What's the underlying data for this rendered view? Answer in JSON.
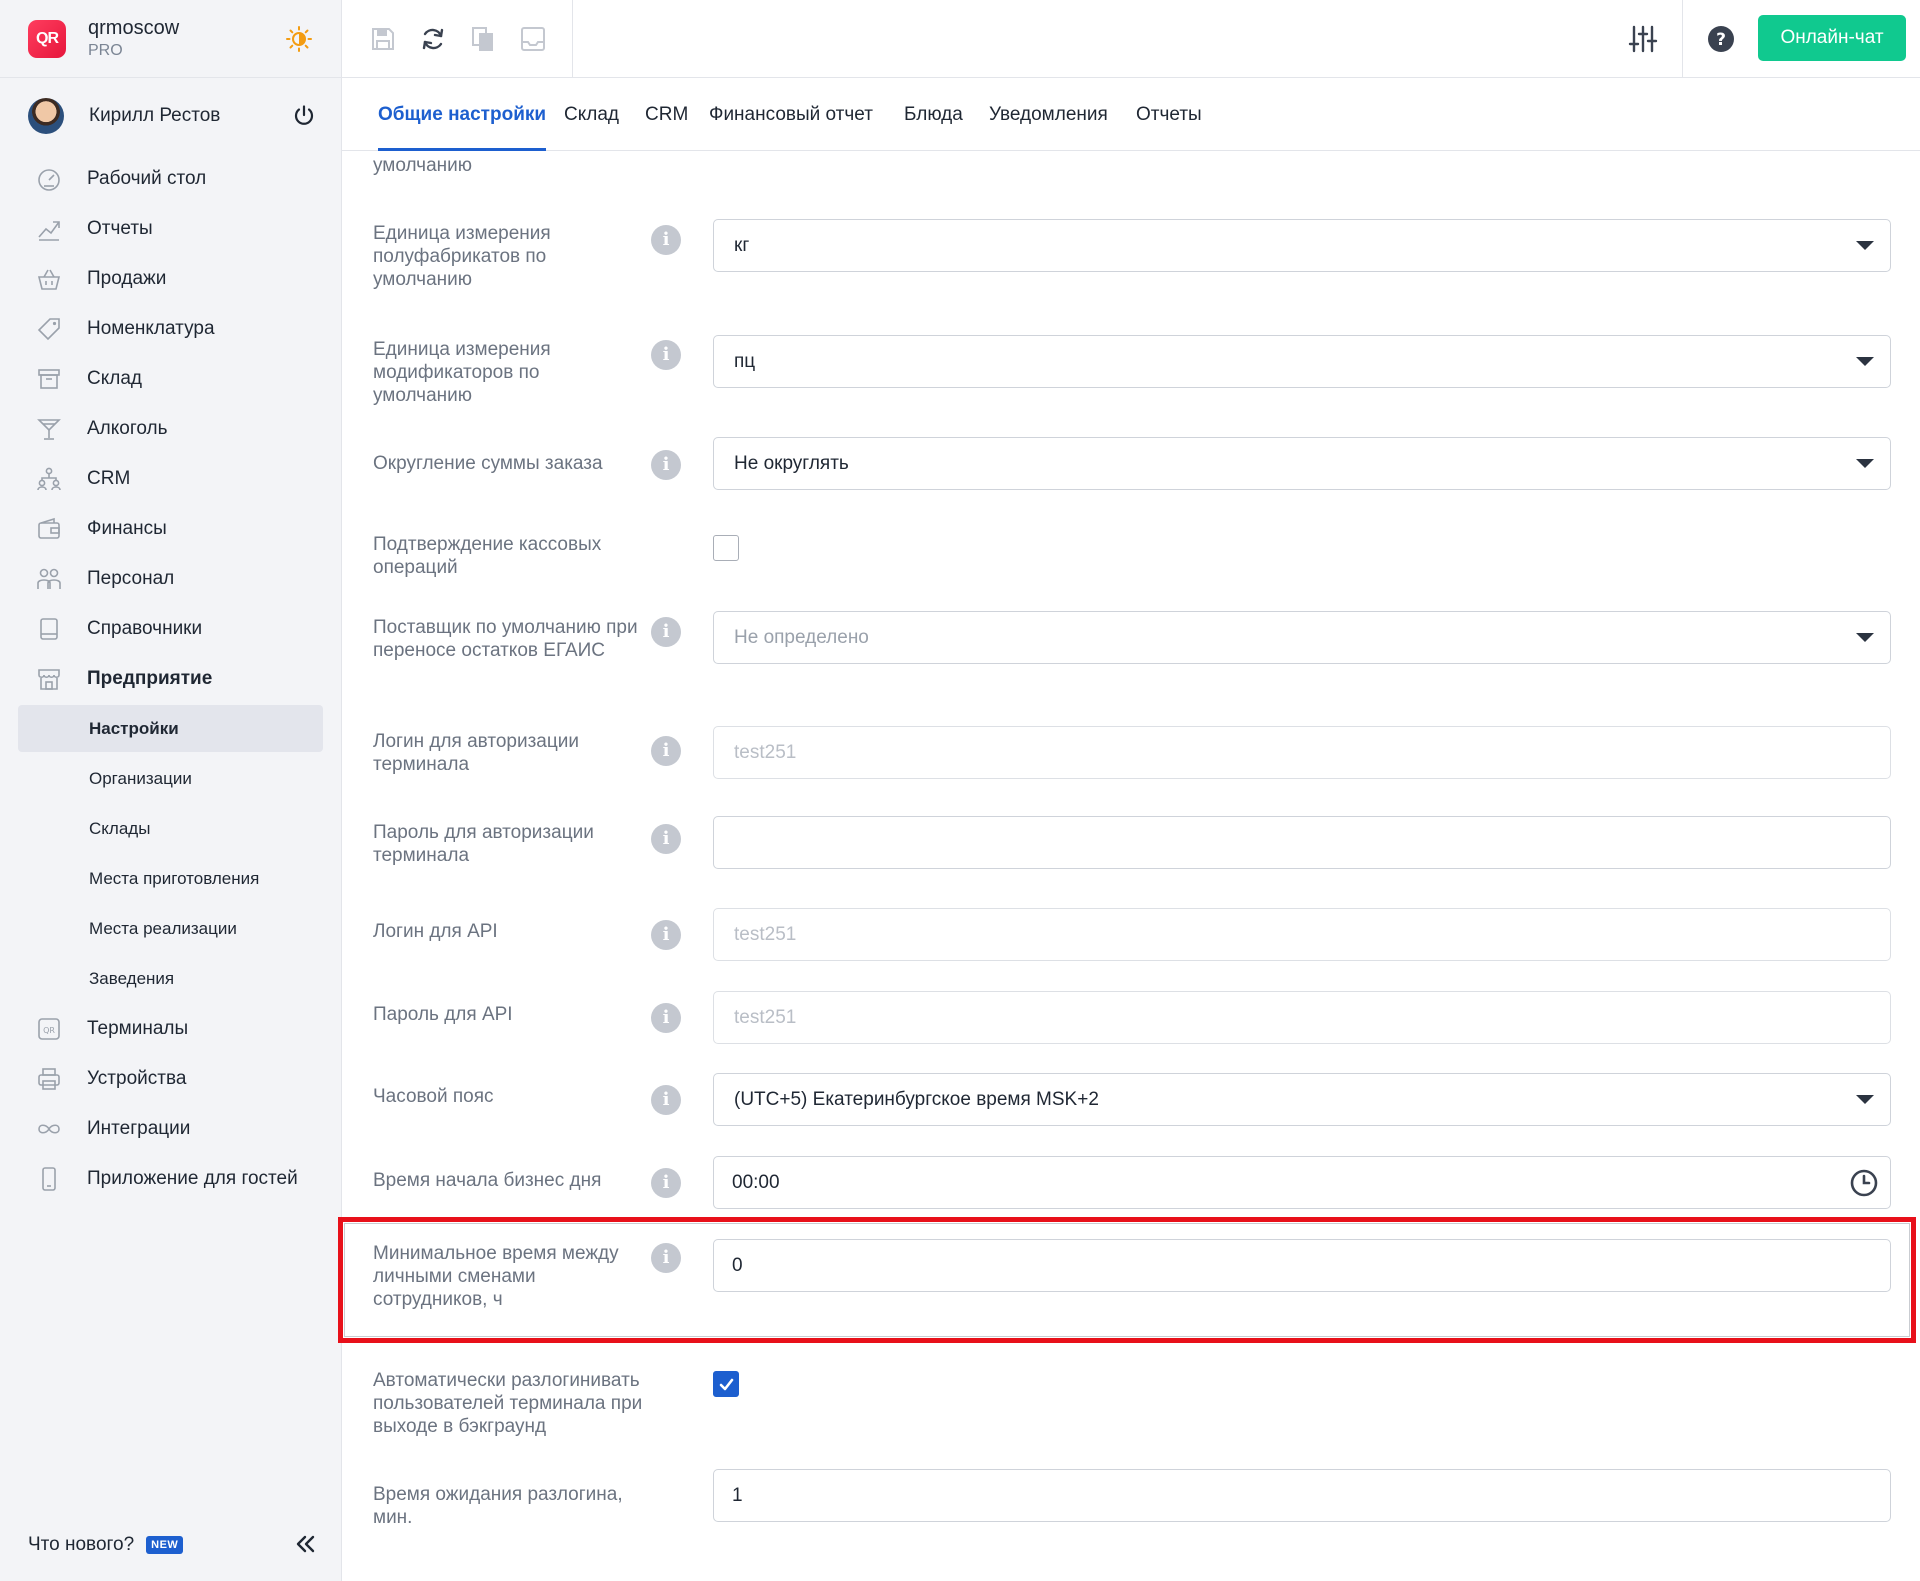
{
  "brand": {
    "name": "qrmoscow",
    "plan": "PRO",
    "logo_text": "QR",
    "icon": "sun-moon-icon"
  },
  "user": {
    "name": "Кирилл Рестов",
    "icon": "power-icon"
  },
  "nav": [
    {
      "label": "Рабочий стол",
      "icon": "dashboard-icon"
    },
    {
      "label": "Отчеты",
      "icon": "chart-icon"
    },
    {
      "label": "Продажи",
      "icon": "basket-icon"
    },
    {
      "label": "Номенклатура",
      "icon": "tag-icon"
    },
    {
      "label": "Склад",
      "icon": "archive-icon"
    },
    {
      "label": "Алкоголь",
      "icon": "cocktail-icon"
    },
    {
      "label": "CRM",
      "icon": "people-tree-icon"
    },
    {
      "label": "Финансы",
      "icon": "wallet-icon"
    },
    {
      "label": "Персонал",
      "icon": "staff-icon"
    },
    {
      "label": "Справочники",
      "icon": "book-icon"
    },
    {
      "label": "Предприятие",
      "icon": "store-icon"
    }
  ],
  "subnav": [
    {
      "label": "Настройки"
    },
    {
      "label": "Организации"
    },
    {
      "label": "Склады"
    },
    {
      "label": "Места приготовления"
    },
    {
      "label": "Места реализации"
    },
    {
      "label": "Заведения"
    }
  ],
  "nav2": [
    {
      "label": "Терминалы",
      "icon": "qr-terminal-icon"
    },
    {
      "label": "Устройства",
      "icon": "printer-icon"
    },
    {
      "label": "Интеграции",
      "icon": "infinity-icon"
    },
    {
      "label": "Приложение для гостей",
      "icon": "phone-icon"
    }
  ],
  "footer": {
    "label": "Что нового?",
    "badge": "NEW"
  },
  "toolbar": {
    "chat_label": "Онлайн-чат"
  },
  "tabs": [
    "Общие настройки",
    "Склад",
    "CRM",
    "Финансовый отчет",
    "Блюда",
    "Уведомления",
    "Отчеты"
  ],
  "form": {
    "partial_label": "умолчанию",
    "fields": [
      {
        "label": "Единица измерения полуфабрикатов по умолчанию",
        "value": "кг"
      },
      {
        "label": "Единица измерения модификаторов по умолчанию",
        "value": "пц"
      },
      {
        "label": "Округление суммы заказа",
        "value": "Не округлять"
      },
      {
        "label": "Подтверждение кассовых операций"
      },
      {
        "label": "Поставщик по умолчанию при переносе остатков ЕГАИС",
        "value": "Не определено"
      },
      {
        "label": "Логин для авторизации терминала",
        "value": "test251"
      },
      {
        "label": "Пароль для авторизации терминала",
        "value": ""
      },
      {
        "label": "Логин для API",
        "value": "test251"
      },
      {
        "label": "Пароль для API",
        "value": "test251"
      },
      {
        "label": "Часовой пояс",
        "value": "(UTC+5) Екатеринбургское время MSK+2"
      },
      {
        "label": "Время начала бизнес дня",
        "value": "00:00"
      },
      {
        "label": "Минимальное время между личными сменами сотрудников, ч",
        "value": "0"
      },
      {
        "label": "Автоматически разлогинивать пользователей терминала при выходе в бэкграунд"
      },
      {
        "label": "Время ожидания разлогина, мин.",
        "value": "1"
      }
    ]
  },
  "colors": {
    "accent": "#1d5fcf",
    "chat": "#10c98f",
    "highlight": "#e8101a"
  }
}
